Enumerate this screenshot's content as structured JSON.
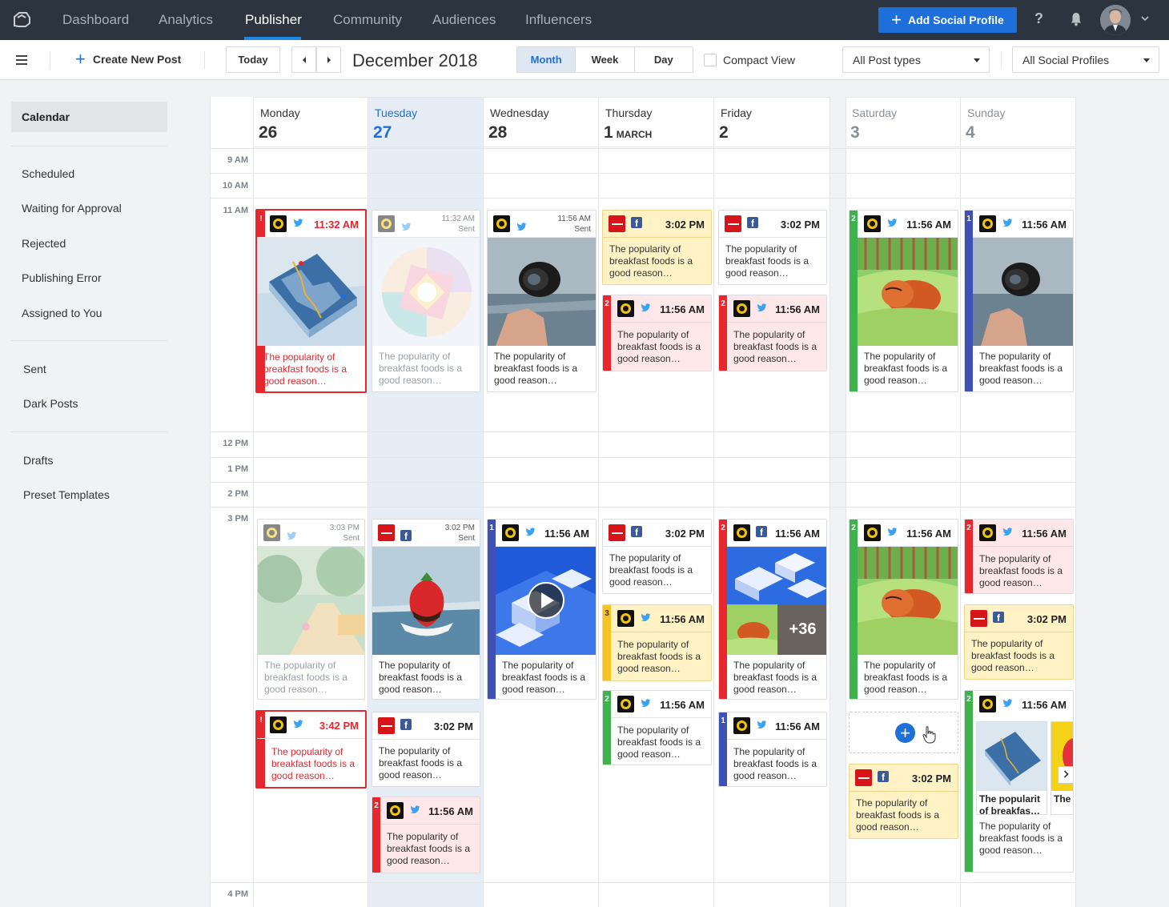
{
  "nav": {
    "tabs": [
      "Dashboard",
      "Analytics",
      "Publisher",
      "Community",
      "Audiences",
      "Influencers"
    ],
    "active": "Publisher",
    "add_profile": "Add Social Profile",
    "help": "?"
  },
  "toolbar": {
    "create": "Create New Post",
    "today": "Today",
    "period": "December 2018",
    "views": [
      "Month",
      "Week",
      "Day"
    ],
    "active_view": "Month",
    "compact": "Compact View",
    "post_types": "All Post types",
    "profiles": "All Social Profiles"
  },
  "sidebar": {
    "header": "Calendar",
    "group1": [
      "Scheduled",
      "Waiting for Approval",
      "Rejected",
      "Publishing Error",
      "Assigned to You"
    ],
    "group2": [
      "Sent",
      "Dark Posts"
    ],
    "group3": [
      "Drafts",
      "Preset Templates"
    ]
  },
  "days": [
    {
      "name": "Monday",
      "num": "26",
      "month": ""
    },
    {
      "name": "Tuesday",
      "num": "27",
      "month": ""
    },
    {
      "name": "Wednesday",
      "num": "28",
      "month": ""
    },
    {
      "name": "Thursday",
      "num": "1",
      "month": "MARCH"
    },
    {
      "name": "Friday",
      "num": "2",
      "month": ""
    },
    {
      "name": "Saturday",
      "num": "3",
      "month": ""
    },
    {
      "name": "Sunday",
      "num": "4",
      "month": ""
    }
  ],
  "times": [
    "9 AM",
    "10 AM",
    "11 AM",
    "12 PM",
    "1 PM",
    "2 PM",
    "3 PM",
    "4 PM"
  ],
  "post": {
    "text_full": "The popularity of breakfast foods is a good reason…",
    "text_bold": "The popularit of breakfas…",
    "text_bold2": "The of br",
    "sent": "Sent",
    "t1132": "11:32 AM",
    "t1132_err": "11:32 AM",
    "t1156": "11:56 AM",
    "t302": "3:02 PM",
    "t303": "3:03 PM",
    "t342": "3:42 PM",
    "more": "+36",
    "err_flag": "!",
    "n1": "1",
    "n2": "2",
    "n3": "3"
  },
  "colors": {
    "topbar": "#2c343f",
    "accent": "#1e6fd9",
    "error": "#e8262e",
    "green": "#3cb44b",
    "yellow": "#f6c324",
    "indigo": "#3f51b5"
  }
}
